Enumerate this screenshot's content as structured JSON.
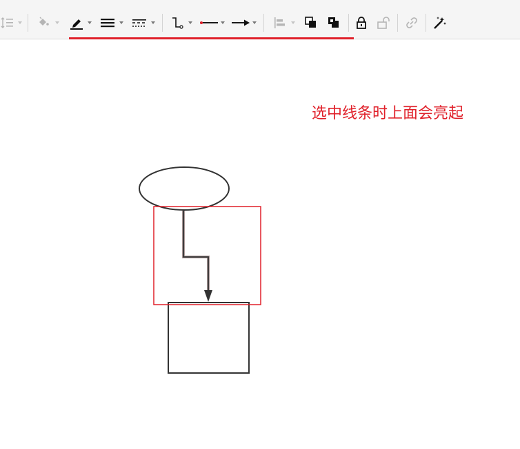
{
  "toolbar": {
    "groups": [
      {
        "name": "spacing",
        "items": [
          "line-spacing-icon"
        ]
      },
      {
        "name": "style",
        "items": [
          "fill-color-icon",
          "line-color-icon",
          "line-width-icon",
          "line-dash-icon"
        ]
      },
      {
        "name": "connector",
        "items": [
          "waypoint-style-icon",
          "line-start-icon",
          "line-end-icon"
        ]
      },
      {
        "name": "arrange",
        "items": [
          "align-icon",
          "to-front-icon",
          "to-back-icon"
        ]
      },
      {
        "name": "lock",
        "items": [
          "lock-icon",
          "unlock-icon"
        ]
      },
      {
        "name": "link",
        "items": [
          "link-icon"
        ]
      },
      {
        "name": "magic",
        "items": [
          "magic-wand-icon"
        ]
      }
    ],
    "highlight_color": "#e0202a"
  },
  "annotation": {
    "text": "选中线条时上面会亮起",
    "color": "#e0202a"
  },
  "diagram": {
    "shapes": [
      {
        "kind": "ellipse",
        "label": ""
      },
      {
        "kind": "rectangle",
        "label": ""
      }
    ],
    "connector": {
      "kind": "orthogonal-arrow",
      "selected": true
    },
    "selection_box_color": "#e0202a"
  }
}
